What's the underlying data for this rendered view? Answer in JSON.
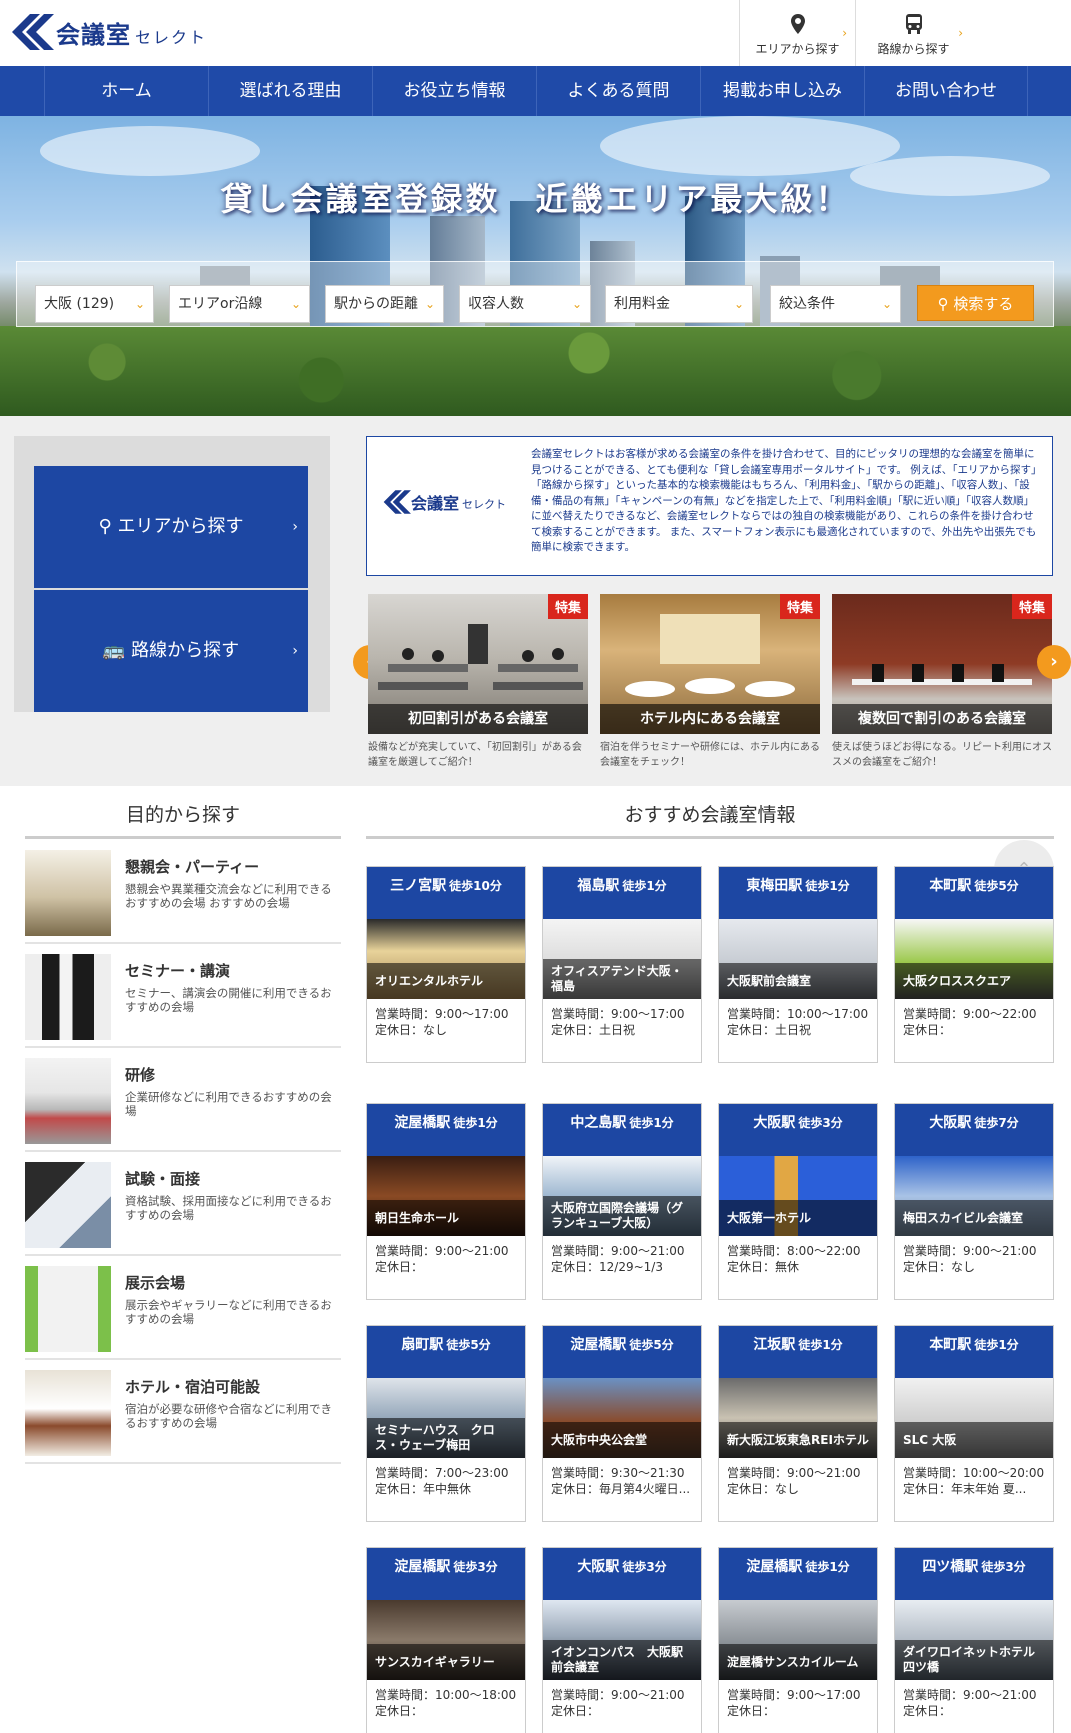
{
  "header": {
    "logo_text": "会議室",
    "logo_sub": "セレクト",
    "area_btn": "エリアから探す",
    "route_btn": "路線から探す"
  },
  "nav": [
    "ホーム",
    "選ばれる理由",
    "お役立ち情報",
    "よくある質問",
    "掲載お申し込み",
    "お問い合わせ"
  ],
  "hero": {
    "title": "貸し会議室登録数　近畿エリア最大級！",
    "selects": [
      "大阪 (129)",
      "エリアor沿線",
      "駅からの距離",
      "収容人数",
      "利用料金",
      "絞込条件"
    ],
    "search_label": "検索する"
  },
  "side_search": {
    "area": "エリアから探す",
    "route": "路線から探す"
  },
  "about": {
    "logo_text": "会議室",
    "logo_sub": "セレクト",
    "text": "会議室セレクトはお客様が求める会議室の条件を掛け合わせて、目的にピッタリの理想的な会議室を簡単に見つけることができる、とても便利な「貸し会議室専用ポータルサイト」です。 例えば、「エリアから探す」「路線から探す」といった基本的な検索機能はもちろん、「利用料金」、「駅からの距離」、「収容人数」、「設備・備品の有無」「キャンペーンの有無」などを指定した上で、「利用料金順」「駅に近い順」「収容人数順」に並べ替えたりできるなど、会議室セレクトならではの独自の検索機能があり、これらの条件を掛け合わせて検索することができます。 また、スマートフォン表示にも最適化されていますので、外出先や出張先でも簡単に検索できます。"
  },
  "features": [
    {
      "tag": "特集",
      "title": "初回割引がある会議室",
      "desc": "設備などが充実していて、「初回割引」がある会議室を厳選してご紹介！"
    },
    {
      "tag": "特集",
      "title": "ホテル内にある会議室",
      "desc": "宿泊を伴うセミナーや研修には、ホテル内にある会議室をチェック！"
    },
    {
      "tag": "特集",
      "title": "複数回で割引のある会議室",
      "desc": "使えば使うほどお得になる。リピート利用にオススメの会議室をご紹介！"
    }
  ],
  "purpose_title": "目的から探す",
  "purposes": [
    {
      "name": "懇親会・パーティー",
      "text": "懇親会や異業種交流会などに利用できるおすすめの会場 おすすめの会場"
    },
    {
      "name": "セミナー・講演",
      "text": "セミナー、講演会の開催に利用できるおすすめの会場"
    },
    {
      "name": "研修",
      "text": "企業研修などに利用できるおすすめの会場"
    },
    {
      "name": "試験・面接",
      "text": "資格試験、採用面接などに利用できるおすすめの会場"
    },
    {
      "name": "展示会場",
      "text": "展示会やギャラリーなどに利用できるおすすめの会場"
    },
    {
      "name": "ホテル・宿泊可能設",
      "text": "宿泊が必要な研修や合宿などに利用できるおすすめの会場"
    }
  ],
  "recommend_title": "おすすめ会議室情報",
  "rooms": [
    {
      "station": "三ノ宮駅",
      "walk": "徒歩10分",
      "name": "オリエンタルホテル",
      "hours": "営業時間：9:00～17:00",
      "closed": "定休日：なし"
    },
    {
      "station": "福島駅",
      "walk": "徒歩1分",
      "name": "オフィスアテンド大阪・福島",
      "hours": "営業時間：9:00～17:00",
      "closed": "定休日：土日祝"
    },
    {
      "station": "東梅田駅",
      "walk": "徒歩1分",
      "name": "大阪駅前会議室",
      "hours": "営業時間：10:00～17:00",
      "closed": "定休日：土日祝"
    },
    {
      "station": "本町駅",
      "walk": "徒歩5分",
      "name": "大阪クロススクエア",
      "hours": "営業時間：9:00～22:00",
      "closed": "定休日："
    },
    {
      "station": "淀屋橋駅",
      "walk": "徒歩1分",
      "name": "朝日生命ホール",
      "hours": "営業時間：9:00～21:00",
      "closed": "定休日："
    },
    {
      "station": "中之島駅",
      "walk": "徒歩1分",
      "name": "大阪府立国際会議場（グランキューブ大阪）",
      "hours": "営業時間：9:00～21:00",
      "closed": "定休日：12/29~1/3"
    },
    {
      "station": "大阪駅",
      "walk": "徒歩3分",
      "name": "大阪第一ホテル",
      "hours": "営業時間：8:00～22:00",
      "closed": "定休日：無休"
    },
    {
      "station": "大阪駅",
      "walk": "徒歩7分",
      "name": "梅田スカイビル会議室",
      "hours": "営業時間：9:00～21:00",
      "closed": "定休日：なし"
    },
    {
      "station": "扇町駅",
      "walk": "徒歩5分",
      "name": "セミナーハウス　クロス・ウェーブ梅田",
      "hours": "営業時間：7:00～23:00",
      "closed": "定休日：年中無休"
    },
    {
      "station": "淀屋橋駅",
      "walk": "徒歩5分",
      "name": "大阪市中央公会堂",
      "hours": "営業時間：9:30～21:30",
      "closed": "定休日：毎月第4火曜日..."
    },
    {
      "station": "江坂駅",
      "walk": "徒歩1分",
      "name": "新大阪江坂東急REIホテル",
      "hours": "営業時間：9:00～21:00",
      "closed": "定休日：なし"
    },
    {
      "station": "本町駅",
      "walk": "徒歩1分",
      "name": "SLC 大阪",
      "hours": "営業時間：10:00～20:00",
      "closed": "定休日：年末年始 夏..."
    },
    {
      "station": "淀屋橋駅",
      "walk": "徒歩3分",
      "name": "サンスカイギャラリー",
      "hours": "営業時間：10:00～18:00",
      "closed": "定休日："
    },
    {
      "station": "大阪駅",
      "walk": "徒歩3分",
      "name": "イオンコンパス　大阪駅前会議室",
      "hours": "営業時間：9:00～21:00",
      "closed": "定休日："
    },
    {
      "station": "淀屋橋駅",
      "walk": "徒歩1分",
      "name": "淀屋橋サンスカイルーム",
      "hours": "営業時間：9:00～17:00",
      "closed": "定休日："
    },
    {
      "station": "四ツ橋駅",
      "walk": "徒歩3分",
      "name": "ダイワロイネットホテル四ツ橋",
      "hours": "営業時間：9:00～21:00",
      "closed": "定休日："
    }
  ],
  "colors": {
    "primary": "#1f4aa8",
    "accent": "#f39a1e",
    "tag_red": "#d9261c"
  }
}
